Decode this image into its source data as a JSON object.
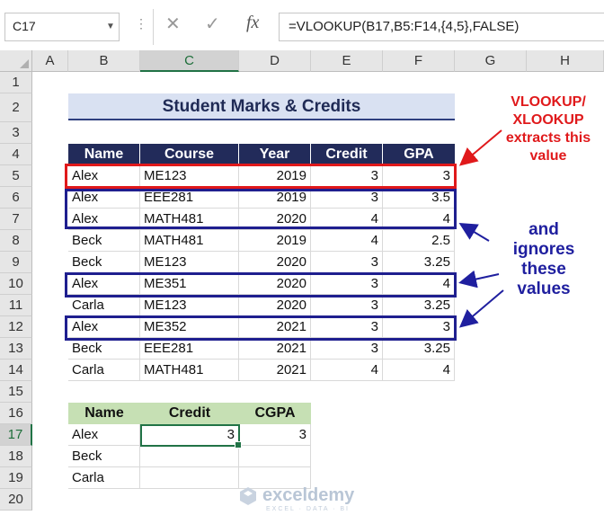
{
  "formula_bar": {
    "name_box": "C17",
    "cancel_icon": "✕",
    "enter_icon": "✓",
    "fx_label": "fx",
    "formula": "=VLOOKUP(B17,B5:F14,{4,5},FALSE)"
  },
  "columns": [
    "A",
    "B",
    "C",
    "D",
    "E",
    "F",
    "G",
    "H"
  ],
  "rows": [
    "1",
    "2",
    "3",
    "4",
    "5",
    "6",
    "7",
    "8",
    "9",
    "10",
    "11",
    "12",
    "13",
    "14",
    "15",
    "16",
    "17",
    "18",
    "19",
    "20"
  ],
  "selected_cell": {
    "column": "C",
    "row": "17"
  },
  "title": "Student Marks & Credits",
  "table": {
    "headers": [
      "Name",
      "Course",
      "Year",
      "Credit",
      "GPA"
    ],
    "rows": [
      [
        "Alex",
        "ME123",
        "2019",
        "3",
        "3"
      ],
      [
        "Alex",
        "EEE281",
        "2019",
        "3",
        "3.5"
      ],
      [
        "Alex",
        "MATH481",
        "2020",
        "4",
        "4"
      ],
      [
        "Beck",
        "MATH481",
        "2019",
        "4",
        "2.5"
      ],
      [
        "Beck",
        "ME123",
        "2020",
        "3",
        "3.25"
      ],
      [
        "Alex",
        "ME351",
        "2020",
        "3",
        "4"
      ],
      [
        "Carla",
        "ME123",
        "2020",
        "3",
        "3.25"
      ],
      [
        "Alex",
        "ME352",
        "2021",
        "3",
        "3"
      ],
      [
        "Beck",
        "EEE281",
        "2021",
        "3",
        "3.25"
      ],
      [
        "Carla",
        "MATH481",
        "2021",
        "4",
        "4"
      ]
    ]
  },
  "result": {
    "headers": [
      "Name",
      "Credit",
      "CGPA"
    ],
    "rows": [
      [
        "Alex",
        "3",
        "3"
      ],
      [
        "Beck",
        "",
        ""
      ],
      [
        "Carla",
        "",
        ""
      ]
    ]
  },
  "annotations": {
    "red_note": [
      "VLOOKUP/",
      "XLOOKUP",
      "extracts this",
      "value"
    ],
    "blue_note": [
      "and",
      "ignores",
      "these",
      "values"
    ]
  },
  "colors": {
    "header_bg": "#222b5a",
    "title_bg": "#d9e1f2",
    "result_header_bg": "#c6e0b4",
    "red": "#e0191b",
    "blue": "#1f1f8f",
    "excel_green": "#217346"
  },
  "watermark": {
    "name": "exceldemy",
    "tagline": "EXCEL · DATA · BI"
  }
}
